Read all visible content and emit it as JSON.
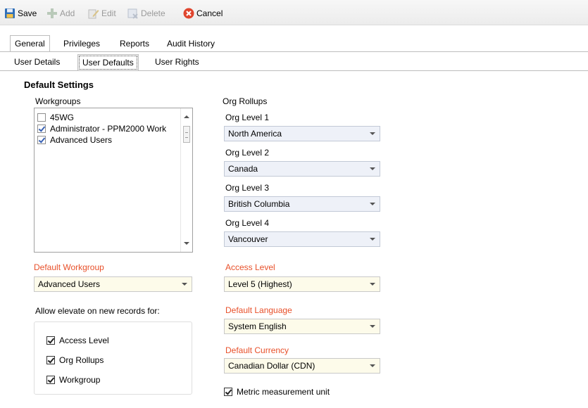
{
  "toolbar": {
    "save": "Save",
    "add": "Add",
    "edit": "Edit",
    "delete": "Delete",
    "cancel": "Cancel"
  },
  "tabs": [
    "General",
    "Privileges",
    "Reports",
    "Audit History"
  ],
  "subtabs": [
    "User Details",
    "User Defaults",
    "User Rights"
  ],
  "section_title": "Default Settings",
  "workgroups": {
    "label": "Workgroups",
    "items": [
      {
        "label": "45WG",
        "checked": false
      },
      {
        "label": "Administrator - PPM2000 Work",
        "checked": true
      },
      {
        "label": "Advanced Users",
        "checked": true
      }
    ]
  },
  "default_workgroup": {
    "label": "Default Workgroup",
    "value": "Advanced Users"
  },
  "elevate": {
    "label": "Allow elevate on new records for:",
    "items": [
      {
        "label": "Access Level",
        "checked": true
      },
      {
        "label": "Org Rollups",
        "checked": true
      },
      {
        "label": "Workgroup",
        "checked": true
      }
    ]
  },
  "org_rollups": {
    "label": "Org Rollups",
    "levels": [
      {
        "label": "Org Level 1",
        "value": "North America"
      },
      {
        "label": "Org Level 2",
        "value": "Canada"
      },
      {
        "label": "Org Level 3",
        "value": "British Columbia"
      },
      {
        "label": "Org Level 4",
        "value": "Vancouver"
      }
    ]
  },
  "access_level": {
    "label": "Access Level",
    "value": "Level 5 (Highest)"
  },
  "default_language": {
    "label": "Default Language",
    "value": "System English"
  },
  "default_currency": {
    "label": "Default Currency",
    "value": "Canadian Dollar (CDN)"
  },
  "metric": {
    "label": "Metric measurement unit",
    "checked": true
  },
  "colors": {
    "required_label": "#e8502a",
    "checkbox_check": "#3a62b4"
  }
}
